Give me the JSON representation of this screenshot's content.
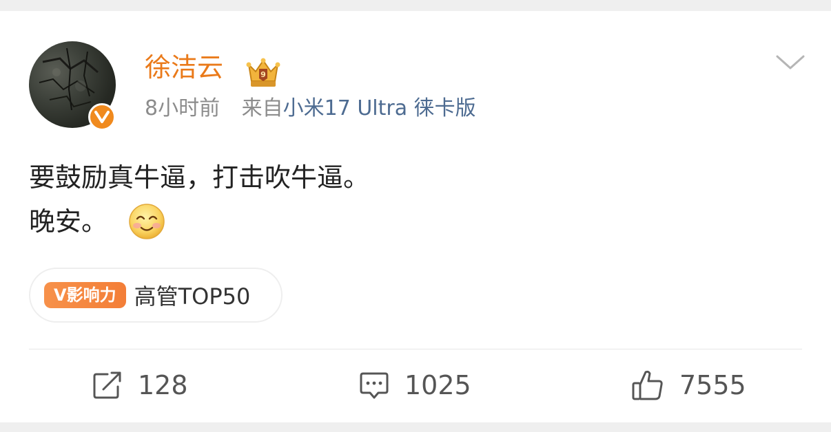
{
  "post": {
    "author": "徐洁云",
    "time": "8小时前",
    "source_prefix": "来自",
    "device": "小米17 Ultra 徕卡版",
    "text_line1": "要鼓励真牛逼，打击吹牛逼。",
    "text_line2": "晚安。"
  },
  "influence": {
    "badge": "V影响力",
    "label": "高管TOP50"
  },
  "actions": {
    "repost_count": "128",
    "comment_count": "1025",
    "like_count": "7555"
  },
  "icons": {
    "verified": "verified-v-icon",
    "crown": "crown-badge-icon",
    "menu": "chevron-down-icon",
    "emoji": "smiley-emoji-icon",
    "repost": "repost-icon",
    "comment": "comment-icon",
    "like": "thumbs-up-icon"
  },
  "colors": {
    "author": "#ea7a1a",
    "device": "#4d6b91",
    "badge": "#f37e37",
    "verified": "#f08a1e"
  }
}
